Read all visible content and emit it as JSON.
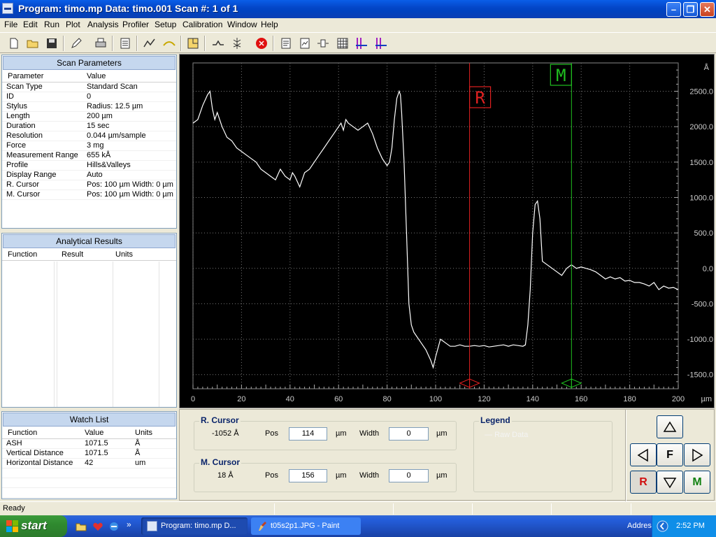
{
  "window": {
    "title": "Program: timo.mp   Data: timo.001   Scan #: 1 of 1",
    "minimize": "–",
    "maximize": "❐",
    "close": "✕"
  },
  "menu": [
    "File",
    "Edit",
    "Run",
    "Plot",
    "Analysis",
    "Profiler",
    "Setup",
    "Calibration",
    "Window",
    "Help"
  ],
  "scan_parameters": {
    "header": "Scan Parameters",
    "col_param": "Parameter",
    "col_value": "Value",
    "rows": [
      [
        "Scan Type",
        "Standard Scan"
      ],
      [
        "ID",
        "0"
      ],
      [
        "Stylus",
        "Radius: 12.5 µm"
      ],
      [
        "Length",
        "200 µm"
      ],
      [
        "Duration",
        "15 sec"
      ],
      [
        "Resolution",
        "0.044 µm/sample"
      ],
      [
        "Force",
        "3 mg"
      ],
      [
        "Measurement Range",
        "655 kÅ"
      ],
      [
        "Profile",
        "Hills&Valleys"
      ],
      [
        "Display Range",
        "Auto"
      ],
      [
        "R. Cursor",
        "Pos: 100 µm Width: 0 µm"
      ],
      [
        "M. Cursor",
        "Pos: 100 µm Width: 0 µm"
      ]
    ]
  },
  "analytical_results": {
    "header": "Analytical Results",
    "col_function": "Function",
    "col_result": "Result",
    "col_units": "Units"
  },
  "watch_list": {
    "header": "Watch List",
    "col_function": "Function",
    "col_value": "Value",
    "col_units": "Units",
    "rows": [
      [
        "ASH",
        "1071.5",
        "Å"
      ],
      [
        "Vertical Distance",
        "1071.5",
        "Å"
      ],
      [
        "Horizontal Distance",
        "42",
        "um"
      ]
    ]
  },
  "chart_data": {
    "type": "line",
    "title": "",
    "xlabel": "µm",
    "ylabel": "Å",
    "xlim": [
      0,
      200
    ],
    "ylim": [
      -1700,
      2900
    ],
    "x_ticks": [
      0,
      20,
      40,
      60,
      80,
      100,
      120,
      140,
      160,
      180,
      200
    ],
    "y_ticks": [
      2500.0,
      2000.0,
      1500.0,
      1000.0,
      500.0,
      0.0,
      -500.0,
      -1000.0,
      -1500.0
    ],
    "y_tick_labels": [
      "2500.0",
      "2000.0",
      "1500.0",
      "1000.0",
      "500.0",
      "0.0",
      "-500.0",
      "-1000.0",
      "-1500.0"
    ],
    "x_tick_labels": [
      "0",
      "20",
      "40",
      "60",
      "80",
      "100",
      "120",
      "140",
      "160",
      "180",
      "200"
    ],
    "grid": true,
    "series": [
      {
        "color": "#ffffff",
        "x": [
          0,
          2,
          4,
          6,
          7,
          8,
          9,
          10,
          12,
          14,
          16,
          18,
          20,
          22,
          24,
          26,
          28,
          30,
          32,
          34,
          36,
          38,
          40,
          41,
          42,
          44,
          46,
          48,
          50,
          52,
          54,
          56,
          58,
          60,
          61,
          62,
          63,
          64,
          66,
          68,
          70,
          72,
          74,
          76,
          78,
          80,
          81,
          82,
          83,
          84,
          85,
          85.5,
          86,
          87,
          88,
          89,
          90,
          91,
          92,
          94,
          96,
          98,
          99,
          100,
          102,
          104,
          106,
          108,
          110,
          112,
          114,
          116,
          118,
          120,
          122,
          124,
          126,
          128,
          130,
          132,
          134,
          136,
          137,
          138,
          139,
          140,
          141,
          142,
          143,
          144,
          146,
          148,
          150,
          152,
          154,
          156,
          158,
          160,
          162,
          164,
          166,
          168,
          170,
          172,
          174,
          176,
          178,
          180,
          182,
          184,
          186,
          188,
          190,
          192,
          194,
          196,
          198,
          200
        ],
        "y": [
          2050,
          2100,
          2300,
          2450,
          2500,
          2250,
          2100,
          2200,
          2000,
          1850,
          1800,
          1700,
          1650,
          1600,
          1550,
          1500,
          1400,
          1350,
          1300,
          1250,
          1400,
          1300,
          1250,
          1350,
          1300,
          1150,
          1350,
          1400,
          1500,
          1600,
          1700,
          1800,
          1900,
          2000,
          2050,
          1950,
          2100,
          2050,
          2000,
          1950,
          2000,
          2050,
          1900,
          1700,
          1550,
          1450,
          1500,
          1700,
          2100,
          2400,
          2500,
          2450,
          2200,
          1500,
          500,
          -500,
          -800,
          -900,
          -950,
          -1050,
          -1150,
          -1300,
          -1400,
          -1250,
          -1000,
          -1050,
          -1100,
          -1100,
          -1080,
          -1100,
          -1100,
          -1090,
          -1100,
          -1090,
          -1110,
          -1100,
          -1090,
          -1080,
          -1100,
          -1080,
          -1090,
          -1100,
          -1080,
          -800,
          -300,
          500,
          900,
          950,
          700,
          100,
          50,
          0,
          -50,
          -100,
          0,
          50,
          0,
          20,
          0,
          -20,
          -50,
          -100,
          -150,
          -120,
          -150,
          -130,
          -180,
          -170,
          -200,
          -200,
          -220,
          -250,
          -200,
          -300,
          -250,
          -280,
          -270,
          -300
        ]
      }
    ],
    "cursors": [
      {
        "label": "R",
        "x": 114,
        "color": "#e02020"
      },
      {
        "label": "M",
        "x": 156,
        "color": "#20c020"
      }
    ]
  },
  "r_cursor": {
    "title": "R. Cursor",
    "reading": "-1052 Å",
    "pos_label": "Pos",
    "pos": "114",
    "unit1": "µm",
    "width_label": "Width",
    "width": "0",
    "unit2": "µm"
  },
  "m_cursor": {
    "title": "M. Cursor",
    "reading": "18 Å",
    "pos_label": "Pos",
    "pos": "156",
    "unit1": "µm",
    "width_label": "Width",
    "width": "0",
    "unit2": "µm"
  },
  "legend": {
    "title": "Legend",
    "entry": "Raw Data"
  },
  "nav": {
    "f": "F",
    "r": "R",
    "m": "M"
  },
  "status": {
    "text": "Ready"
  },
  "taskbar": {
    "start": "start",
    "tasks": [
      "Program: timo.mp   D...",
      "t05s2p1.JPG - Paint"
    ],
    "address": "Address",
    "clock": "2:52 PM",
    "chevron": "»"
  }
}
